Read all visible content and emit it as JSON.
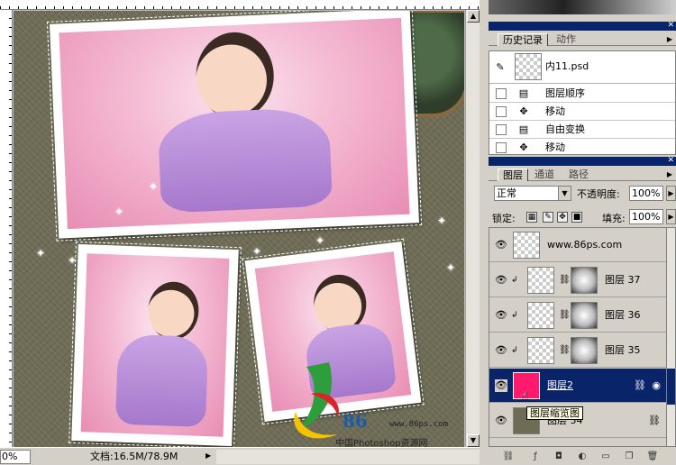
{
  "document": {
    "zoom": "0%",
    "doc_info": "文档:16.5M/78.9M",
    "watermark": {
      "brand_number": "86",
      "url": "www.86ps.com",
      "site_name": "中国Photoshop资源网"
    }
  },
  "history_panel": {
    "tabs": [
      {
        "label": "历史记录",
        "active": true
      },
      {
        "label": "动作",
        "active": false
      }
    ],
    "snapshot": {
      "label": "内11.psd"
    },
    "items": [
      {
        "label": "图层顺序",
        "icon": "document-icon"
      },
      {
        "label": "移动",
        "icon": "move-icon"
      },
      {
        "label": "自由变换",
        "icon": "document-icon"
      },
      {
        "label": "移动",
        "icon": "move-icon"
      }
    ]
  },
  "layers_panel": {
    "tabs": [
      {
        "label": "图层",
        "active": true
      },
      {
        "label": "通道",
        "active": false
      },
      {
        "label": "路径",
        "active": false
      }
    ],
    "blend_mode": "正常",
    "opacity_label": "不透明度:",
    "opacity_value": "100%",
    "lock_label": "锁定:",
    "fill_label": "填充:",
    "fill_value": "100%",
    "layers": [
      {
        "name": "www.86ps.com",
        "type": "text"
      },
      {
        "name": "图层 37",
        "type": "clipped-with-mask"
      },
      {
        "name": "图层 36",
        "type": "clipped-with-mask"
      },
      {
        "name": "图层 35",
        "type": "clipped-with-mask"
      },
      {
        "name": "图层2",
        "type": "selected"
      },
      {
        "name": "图层 34",
        "type": "linked"
      }
    ],
    "tooltip": "图层缩览图"
  },
  "colors": {
    "selection_blue": "#0a246a",
    "panel_gray": "#d4d0c8",
    "layer2_thumb": "#ff1a6e",
    "canvas_bg": "#6e6c55"
  }
}
